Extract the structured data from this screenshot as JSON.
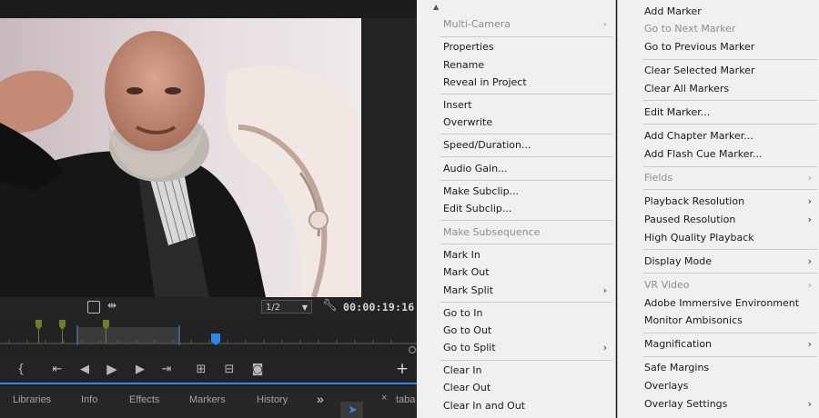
{
  "monitor": {
    "resolution": "1/2",
    "timecode": "00:00:19:16",
    "tabs": [
      "Libraries",
      "Info",
      "Effects",
      "Markers",
      "History"
    ],
    "overflow_label": "»",
    "project_tab": "taba",
    "close_label": "×"
  },
  "menu_left": {
    "items": [
      {
        "label": "Multi-Camera",
        "disabled": true,
        "submenu": true
      },
      {
        "label": "Properties"
      },
      {
        "label": "Rename"
      },
      {
        "label": "Reveal in Project"
      },
      {
        "label": "Insert"
      },
      {
        "label": "Overwrite"
      },
      {
        "label": "Speed/Duration..."
      },
      {
        "label": "Audio Gain..."
      },
      {
        "label": "Make Subclip..."
      },
      {
        "label": "Edit Subclip..."
      },
      {
        "label": "Make Subsequence",
        "disabled": true
      },
      {
        "label": "Mark In"
      },
      {
        "label": "Mark Out"
      },
      {
        "label": "Mark Split",
        "submenu": true
      },
      {
        "label": "Go to In"
      },
      {
        "label": "Go to Out"
      },
      {
        "label": "Go to Split",
        "submenu": true
      },
      {
        "label": "Clear In"
      },
      {
        "label": "Clear Out"
      },
      {
        "label": "Clear In and Out"
      }
    ]
  },
  "menu_right": {
    "items": [
      {
        "label": "Add Marker"
      },
      {
        "label": "Go to Next Marker",
        "disabled": true
      },
      {
        "label": "Go to Previous Marker"
      },
      {
        "label": "Clear Selected Marker"
      },
      {
        "label": "Clear All Markers"
      },
      {
        "label": "Edit Marker..."
      },
      {
        "label": "Add Chapter Marker..."
      },
      {
        "label": "Add Flash Cue Marker..."
      },
      {
        "label": "Fields",
        "disabled": true,
        "submenu": true
      },
      {
        "label": "Playback Resolution",
        "submenu": true
      },
      {
        "label": "Paused Resolution",
        "submenu": true
      },
      {
        "label": "High Quality Playback"
      },
      {
        "label": "Display Mode",
        "submenu": true
      },
      {
        "label": "VR Video",
        "disabled": true,
        "submenu": true
      },
      {
        "label": "Adobe Immersive Environment"
      },
      {
        "label": "Monitor Ambisonics"
      },
      {
        "label": "Magnification",
        "submenu": true
      },
      {
        "label": "Safe Margins"
      },
      {
        "label": "Overlays"
      },
      {
        "label": "Overlay Settings",
        "submenu": true
      }
    ]
  }
}
